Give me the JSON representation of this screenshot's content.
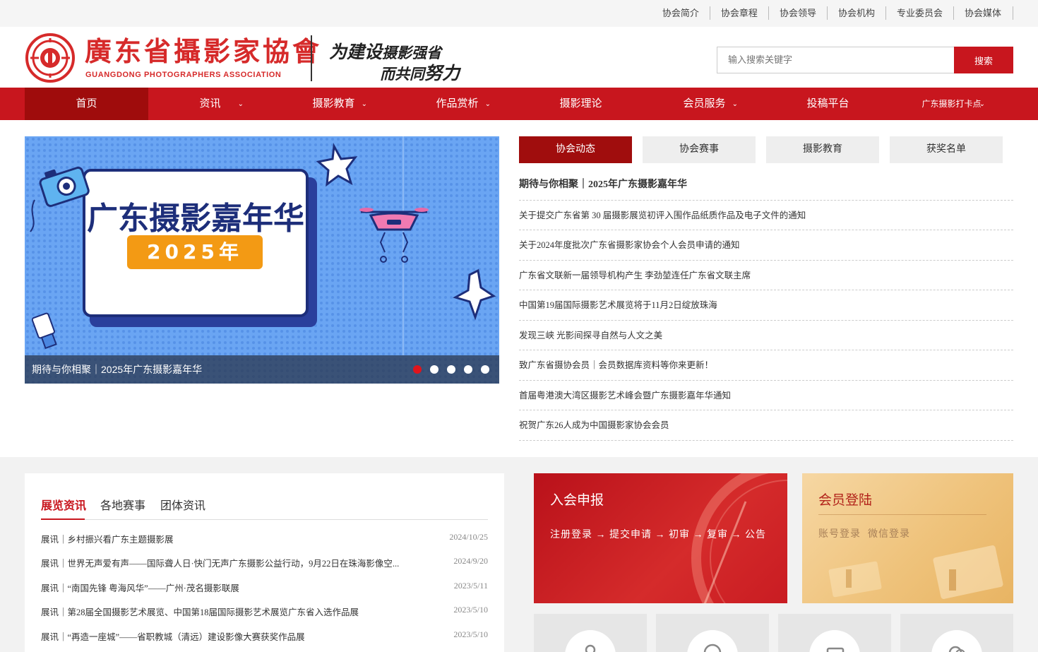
{
  "topbar": {
    "links": [
      "协会简介",
      "协会章程",
      "协会领导",
      "协会机构",
      "专业委员会",
      "协会媒体"
    ]
  },
  "header": {
    "logo_cn": "廣东省攝影家協會",
    "logo_en": "GUANGDONG  PHOTOGRAPHERS  ASSOCIATION",
    "slogan_line1_a": "为建设",
    "slogan_line1_b": "摄影强省",
    "slogan_line2_a": "而共同",
    "slogan_line2_b": "努力",
    "search_placeholder": "输入搜索关键字",
    "search_button": "搜索"
  },
  "nav": {
    "items": [
      {
        "label": "首页",
        "dropdown": false
      },
      {
        "label": "资讯",
        "dropdown": true
      },
      {
        "label": "摄影教育",
        "dropdown": true
      },
      {
        "label": "作品赏析",
        "dropdown": true
      },
      {
        "label": "摄影理论",
        "dropdown": false
      },
      {
        "label": "会员服务",
        "dropdown": true
      },
      {
        "label": "投稿平台",
        "dropdown": false
      },
      {
        "label": "广东摄影打卡点",
        "dropdown": true
      }
    ]
  },
  "banner": {
    "headline": "广东摄影嘉年华",
    "year_badge": "2025年",
    "caption": "期待与你相聚｜2025年广东摄影嘉年华",
    "slide_count": 5,
    "active_slide": 1
  },
  "news": {
    "tabs": [
      "协会动态",
      "协会赛事",
      "摄影教育",
      "获奖名单"
    ],
    "items": [
      "期待与你相聚｜2025年广东摄影嘉年华",
      "关于提交广东省第 30 届摄影展览初评入围作品纸质作品及电子文件的通知",
      "关于2024年度批次广东省摄影家协会个人会员申请的通知",
      "广东省文联新一届领导机构产生 李劲堃连任广东省文联主席",
      "中国第19届国际摄影艺术展览将于11月2日绽放珠海",
      "发现三峡 光影间探寻自然与人文之美",
      "致广东省摄协会员｜会员数据库资料等你来更新！",
      "首届粤港澳大湾区摄影艺术峰会暨广东摄影嘉年华通知",
      "祝贺广东26人成为中国摄影家协会会员"
    ]
  },
  "exhibition": {
    "tabs": [
      "展览资讯",
      "各地赛事",
      "团体资讯"
    ],
    "rows": [
      {
        "title": "展讯｜乡村振兴看广东主题摄影展",
        "date": "2024/10/25"
      },
      {
        "title": "展讯｜世界无声爱有声——国际聋人日·快门无声广东摄影公益行动，9月22日在珠海影像空...",
        "date": "2024/9/20"
      },
      {
        "title": "展讯｜“南国先锋 粤海风华”——广州·茂名摄影联展",
        "date": "2023/5/11"
      },
      {
        "title": "展讯｜第28届全国摄影艺术展览、中国第18届国际摄影艺术展览广东省入选作品展",
        "date": "2023/5/10"
      },
      {
        "title": "展讯｜“再造一座城”——省职教城（清远）建设影像大赛获奖作品展",
        "date": "2023/5/10"
      }
    ]
  },
  "join_card": {
    "title": "入会申报",
    "steps": "注册登录 → 提交申请 → 初审 → 复审 → 公告"
  },
  "login_card": {
    "title": "会员登陆",
    "links": [
      "账号登录",
      "微信登录"
    ]
  },
  "colors": {
    "brand_red": "#c8161e",
    "nav_active": "#9f0c0c",
    "tab_active": "#a00d0d"
  }
}
